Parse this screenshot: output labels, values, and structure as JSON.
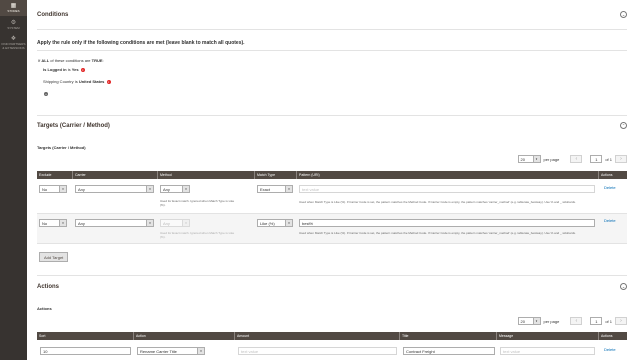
{
  "sidebar": {
    "items": [
      {
        "label": "STORES",
        "icon": "store-icon",
        "active": true
      },
      {
        "label": "SYSTEM",
        "icon": "gear-icon",
        "active": false
      },
      {
        "label": "FIND PARTNERS & EXTENSIONS",
        "icon": "blocks-icon",
        "active": false
      }
    ]
  },
  "conditions": {
    "title": "Conditions",
    "collapse_glyph": "⌄",
    "rule_heading": "Apply the rule only if the following conditions are met (leave blank to match all quotes).",
    "if_prefix": "If",
    "aggregator": "ALL",
    "of_these": "of these conditions are",
    "value": "TRUE",
    "colon": ":",
    "lines": [
      {
        "attribute": "Is Logged in",
        "operator": "is",
        "value": "Yes"
      },
      {
        "attribute": "Shipping Country",
        "operator": "is",
        "value": "United States"
      }
    ]
  },
  "targets": {
    "title": "Targets (Carrier / Method)",
    "collapse_glyph": "⌃",
    "sub_label": "Targets (Carrier / Method)",
    "pager": {
      "per_page": "20",
      "per_page_label": "per page",
      "current": "1",
      "of": "of 1"
    },
    "columns": [
      "Exclude",
      "Carrier",
      "Method",
      "Match Type",
      "Pattern (URI)",
      "Actions"
    ],
    "rows": [
      {
        "exclude": "No",
        "carrier": "Any",
        "method": "Any",
        "method_disabled": false,
        "method_note": "Used for Exact match. Ignored when Match Type is Like (%).",
        "match_type": "Exact",
        "pattern": "",
        "pattern_placeholder": "text value",
        "pattern_note": "Used when Match Type is Like (%). If Carrier Code is set, the pattern matches the Method Code. If Carrier Code is empty, the pattern matches 'carrier_method' (e.g. tablerate_bestway). Use % and _ wildcards.",
        "action": "Delete"
      },
      {
        "exclude": "No",
        "carrier": "Any",
        "method": "Any",
        "method_disabled": true,
        "method_note": "Used for Exact match. Ignored when Match Type is Like (%).",
        "match_type": "Like (%)",
        "pattern": "best%",
        "pattern_placeholder": "",
        "pattern_note": "Used when Match Type is Like (%). If Carrier Code is set, the pattern matches the Method Code. If Carrier Code is empty, the pattern matches 'carrier_method' (e.g. tablerate_bestway). Use % and _ wildcards.",
        "action": "Delete"
      }
    ],
    "add_button": "Add Target"
  },
  "actions": {
    "title": "Actions",
    "collapse_glyph": "⌄",
    "sub_label": "Actions",
    "pager": {
      "per_page": "20",
      "per_page_label": "per page",
      "current": "1",
      "of": "of 1"
    },
    "columns": [
      "Sort",
      "Action",
      "Amount",
      "Title",
      "Message",
      "Actions"
    ],
    "rows": [
      {
        "sort": "10",
        "action": "Rename Carrier Title",
        "amount": "",
        "amount_placeholder": "text value",
        "title": "Contract Freight",
        "message": "",
        "message_placeholder": "text value",
        "row_action": "Delete"
      }
    ]
  },
  "colors": {
    "sidebar_bg": "#373330",
    "grid_header_bg": "#514943",
    "link": "#006bb4",
    "remove": "#e22626"
  }
}
